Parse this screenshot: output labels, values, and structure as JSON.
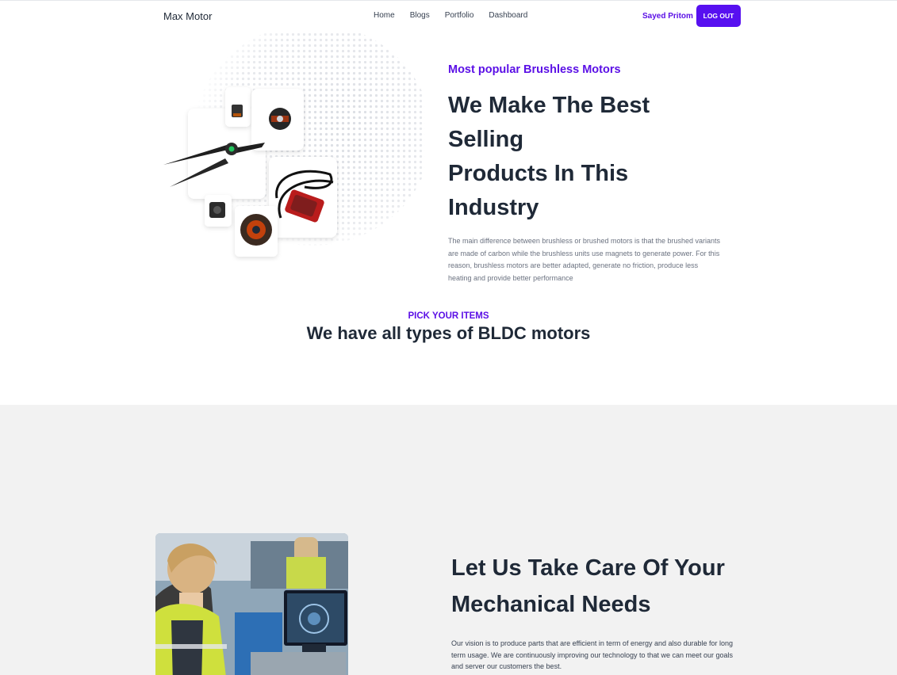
{
  "navbar": {
    "brand": "Max Motor",
    "links": [
      "Home",
      "Blogs",
      "Portfolio",
      "Dashboard"
    ],
    "user_name": "Sayed Pritom",
    "logout_label": "LOG OUT",
    "accent_color": "#5710f0"
  },
  "hero": {
    "kicker": "Most popular Brushless Motors",
    "title_line1": "We Make The Best Selling",
    "title_line2": "Products In This Industry",
    "description": "The main difference between brushless or brushed motors is that the brushed variants are made of carbon while the brushless units use magnets to generate power. For this reason, brushless motors are better adapted, generate no friction, produce less heating and provide better performance"
  },
  "pick": {
    "kicker": "PICK YOUR ITEMS",
    "title": "We have all types of BLDC motors"
  },
  "care": {
    "title_line1": "Let Us Take Care Of Your",
    "title_line2": "Mechanical Needs",
    "description": "Our vision is to produce parts that are efficient in term of energy and also durable for long term usage. We are continuously improving our technology to that we can meet our goals and server our customers the best."
  }
}
